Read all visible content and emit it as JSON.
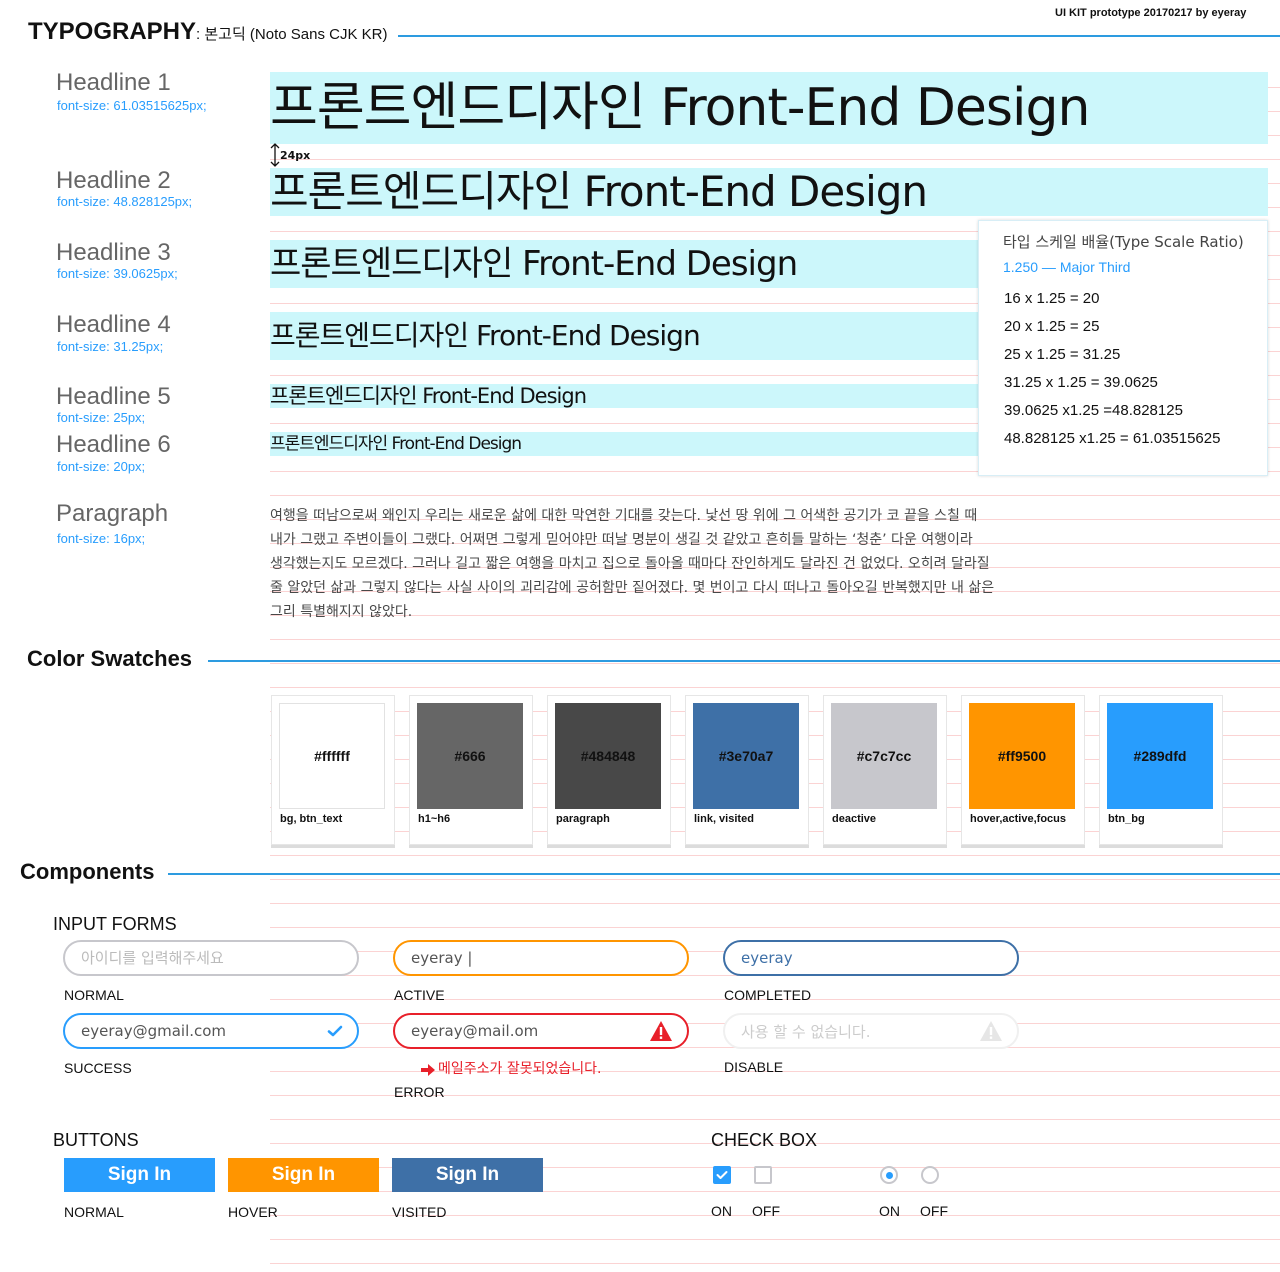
{
  "credit": "UI KIT prototype 20170217 by eyeray",
  "typography": {
    "title": "TYPOGRAPHY",
    "subtitle": ": 본고딕 (Noto Sans CJK KR)",
    "spacing_note": "24px",
    "headlines": [
      {
        "label": "Headline 1",
        "size": "font-size: 61.03515625px;",
        "sample": "프론트엔드디자인 Front-End Design"
      },
      {
        "label": "Headline 2",
        "size": "font-size: 48.828125px;",
        "sample": "프론트엔드디자인 Front-End Design"
      },
      {
        "label": "Headline 3",
        "size": "font-size: 39.0625px;",
        "sample": "프론트엔드디자인 Front-End Design"
      },
      {
        "label": "Headline 4",
        "size": "font-size: 31.25px;",
        "sample": "프론트엔드디자인 Front-End Design"
      },
      {
        "label": "Headline 5",
        "size": "font-size: 25px;",
        "sample": "프론트엔드디자인 Front-End Design"
      },
      {
        "label": "Headline 6",
        "size": "font-size: 20px;",
        "sample": "프론트엔드디자인 Front-End Design"
      }
    ],
    "paragraph": {
      "label": "Paragraph",
      "size": "font-size: 16px;",
      "lines": [
        "여행을 떠남으로써 왜인지 우리는 새로운 삶에 대한 막연한 기대를 갖는다. 낯선 땅 위에 그 어색한 공기가 코 끝을 스칠 때",
        "내가 그랬고 주변이들이 그랬다. 어쩌면 그렇게 믿어야만 떠날 명분이 생길 것 같았고 흔히들 말하는 ‘청춘’ 다운 여행이라",
        "생각했는지도 모르겠다. 그러나 길고 짧은 여행을 마치고 집으로 돌아올 때마다 잔인하게도 달라진 건 없었다. 오히려 달라질",
        "줄 알았던 삶과 그렇지 않다는 사실 사이의 괴리감에 공허함만 짙어졌다. 몇 번이고 다시 떠나고 돌아오길 반복했지만 내 삶은",
        "그리 특별해지지 않았다."
      ]
    },
    "scale_box": {
      "title": "타입 스케일 배율(Type Scale Ratio)",
      "ratio": "1.250 — Major Third",
      "lines": [
        "16 x 1.25 = 20",
        "20 x 1.25 = 25",
        "25 x 1.25 = 31.25",
        "31.25 x 1.25 = 39.0625",
        "39.0625 x1.25 =48.828125",
        "48.828125 x1.25 = 61.03515625"
      ]
    }
  },
  "swatches": {
    "title": "Color Swatches",
    "items": [
      {
        "hex": "#ffffff",
        "label": "bg, btn_text",
        "color": "#ffffff"
      },
      {
        "hex": "#666",
        "label": "h1~h6",
        "color": "#666666"
      },
      {
        "hex": "#484848",
        "label": "paragraph",
        "color": "#484848"
      },
      {
        "hex": "#3e70a7",
        "label": "link, visited",
        "color": "#3e70a7"
      },
      {
        "hex": "#c7c7cc",
        "label": "deactive",
        "color": "#c7c7cc"
      },
      {
        "hex": "#ff9500",
        "label": "hover,active,focus",
        "color": "#ff9500"
      },
      {
        "hex": "#289dfd",
        "label": "btn_bg",
        "color": "#289dfd"
      }
    ]
  },
  "components": {
    "title": "Components",
    "input_forms": {
      "title": "INPUT FORMS",
      "normal": {
        "placeholder": "아이디를 입력해주세요",
        "label": "NORMAL"
      },
      "active": {
        "value": "eyeray |",
        "label": "ACTIVE"
      },
      "completed": {
        "value": "eyeray",
        "label": "COMPLETED"
      },
      "success": {
        "value": "eyeray@gmail.com",
        "label": "SUCCESS"
      },
      "error": {
        "value": "eyeray@mail.om",
        "label": "ERROR",
        "message": "메일주소가 잘못되었습니다."
      },
      "disable": {
        "placeholder": "사용 할 수 없습니다.",
        "label": "DISABLE"
      }
    },
    "buttons": {
      "title": "BUTTONS",
      "items": [
        {
          "text": "Sign In",
          "label": "NORMAL",
          "color": "#289dfd"
        },
        {
          "text": "Sign In",
          "label": "HOVER",
          "color": "#ff9500"
        },
        {
          "text": "Sign In",
          "label": "VISITED",
          "color": "#3e70a7"
        }
      ]
    },
    "checkbox": {
      "title": "CHECK BOX",
      "on": "ON",
      "off": "OFF",
      "radio_on": "ON",
      "radio_off": "OFF"
    }
  },
  "colors": {
    "accent": "#289dfd",
    "active": "#ff9500",
    "completed": "#3e70a7",
    "error": "#e8202a",
    "disabled": "#e6e6e6",
    "normal_border": "#c7c7cc"
  }
}
